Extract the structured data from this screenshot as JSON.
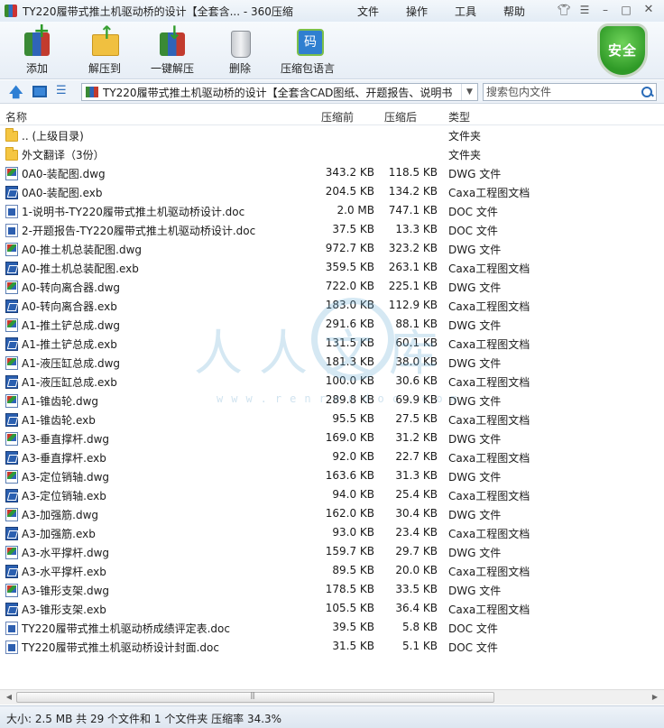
{
  "window": {
    "title": "TY220履带式推土机驱动桥的设计【全套含... - 360压缩",
    "menu": [
      "文件",
      "操作",
      "工具",
      "帮助"
    ]
  },
  "toolbar": {
    "buttons": [
      {
        "label": "添加",
        "icon": "add-archive-icon"
      },
      {
        "label": "解压到",
        "icon": "extract-to-icon"
      },
      {
        "label": "一键解压",
        "icon": "one-click-extract-icon"
      },
      {
        "label": "删除",
        "icon": "trash-icon"
      },
      {
        "label": "压缩包语言",
        "icon": "archive-language-icon"
      }
    ],
    "security_badge": "安全"
  },
  "address": {
    "path": "TY220履带式推土机驱动桥的设计【全套含CAD图纸、开题报告、说明书",
    "search_placeholder": "搜索包内文件"
  },
  "columns": {
    "name": "名称",
    "original_size": "压缩前",
    "compressed_size": "压缩后",
    "type": "类型"
  },
  "files": [
    {
      "name": ".. (上级目录)",
      "orig": "",
      "comp": "",
      "type": "文件夹",
      "icon": "folder"
    },
    {
      "name": "外文翻译（3份）",
      "orig": "",
      "comp": "",
      "type": "文件夹",
      "icon": "folder"
    },
    {
      "name": "0A0-装配图.dwg",
      "orig": "343.2 KB",
      "comp": "118.5 KB",
      "type": "DWG 文件",
      "icon": "dwg"
    },
    {
      "name": "0A0-装配图.exb",
      "orig": "204.5 KB",
      "comp": "134.2 KB",
      "type": "Caxa工程图文档",
      "icon": "exb"
    },
    {
      "name": "1-说明书-TY220履带式推土机驱动桥设计.doc",
      "orig": "2.0 MB",
      "comp": "747.1 KB",
      "type": "DOC 文件",
      "icon": "doc"
    },
    {
      "name": "2-开题报告-TY220履带式推土机驱动桥设计.doc",
      "orig": "37.5 KB",
      "comp": "13.3 KB",
      "type": "DOC 文件",
      "icon": "doc"
    },
    {
      "name": "A0-推土机总装配图.dwg",
      "orig": "972.7 KB",
      "comp": "323.2 KB",
      "type": "DWG 文件",
      "icon": "dwg"
    },
    {
      "name": "A0-推土机总装配图.exb",
      "orig": "359.5 KB",
      "comp": "263.1 KB",
      "type": "Caxa工程图文档",
      "icon": "exb"
    },
    {
      "name": "A0-转向离合器.dwg",
      "orig": "722.0 KB",
      "comp": "225.1 KB",
      "type": "DWG 文件",
      "icon": "dwg"
    },
    {
      "name": "A0-转向离合器.exb",
      "orig": "183.0 KB",
      "comp": "112.9 KB",
      "type": "Caxa工程图文档",
      "icon": "exb"
    },
    {
      "name": "A1-推土铲总成.dwg",
      "orig": "291.6 KB",
      "comp": "88.1 KB",
      "type": "DWG 文件",
      "icon": "dwg"
    },
    {
      "name": "A1-推土铲总成.exb",
      "orig": "131.5 KB",
      "comp": "60.1 KB",
      "type": "Caxa工程图文档",
      "icon": "exb"
    },
    {
      "name": "A1-液压缸总成.dwg",
      "orig": "181.3 KB",
      "comp": "38.0 KB",
      "type": "DWG 文件",
      "icon": "dwg"
    },
    {
      "name": "A1-液压缸总成.exb",
      "orig": "100.0 KB",
      "comp": "30.6 KB",
      "type": "Caxa工程图文档",
      "icon": "exb"
    },
    {
      "name": "A1-锥齿轮.dwg",
      "orig": "289.8 KB",
      "comp": "69.9 KB",
      "type": "DWG 文件",
      "icon": "dwg"
    },
    {
      "name": "A1-锥齿轮.exb",
      "orig": "95.5 KB",
      "comp": "27.5 KB",
      "type": "Caxa工程图文档",
      "icon": "exb"
    },
    {
      "name": "A3-垂直撑杆.dwg",
      "orig": "169.0 KB",
      "comp": "31.2 KB",
      "type": "DWG 文件",
      "icon": "dwg"
    },
    {
      "name": "A3-垂直撑杆.exb",
      "orig": "92.0 KB",
      "comp": "22.7 KB",
      "type": "Caxa工程图文档",
      "icon": "exb"
    },
    {
      "name": "A3-定位销轴.dwg",
      "orig": "163.6 KB",
      "comp": "31.3 KB",
      "type": "DWG 文件",
      "icon": "dwg"
    },
    {
      "name": "A3-定位销轴.exb",
      "orig": "94.0 KB",
      "comp": "25.4 KB",
      "type": "Caxa工程图文档",
      "icon": "exb"
    },
    {
      "name": "A3-加强筋.dwg",
      "orig": "162.0 KB",
      "comp": "30.4 KB",
      "type": "DWG 文件",
      "icon": "dwg"
    },
    {
      "name": "A3-加强筋.exb",
      "orig": "93.0 KB",
      "comp": "23.4 KB",
      "type": "Caxa工程图文档",
      "icon": "exb"
    },
    {
      "name": "A3-水平撑杆.dwg",
      "orig": "159.7 KB",
      "comp": "29.7 KB",
      "type": "DWG 文件",
      "icon": "dwg"
    },
    {
      "name": "A3-水平撑杆.exb",
      "orig": "89.5 KB",
      "comp": "20.0 KB",
      "type": "Caxa工程图文档",
      "icon": "exb"
    },
    {
      "name": "A3-锥形支架.dwg",
      "orig": "178.5 KB",
      "comp": "33.5 KB",
      "type": "DWG 文件",
      "icon": "dwg"
    },
    {
      "name": "A3-锥形支架.exb",
      "orig": "105.5 KB",
      "comp": "36.4 KB",
      "type": "Caxa工程图文档",
      "icon": "exb"
    },
    {
      "name": "TY220履带式推土机驱动桥成绩评定表.doc",
      "orig": "39.5 KB",
      "comp": "5.8 KB",
      "type": "DOC 文件",
      "icon": "doc"
    },
    {
      "name": "TY220履带式推土机驱动桥设计封面.doc",
      "orig": "31.5 KB",
      "comp": "5.1 KB",
      "type": "DOC 文件",
      "icon": "doc"
    }
  ],
  "watermark": {
    "text": "人人文库",
    "url": "www.renrendoc.com"
  },
  "status": {
    "text": "大小: 2.5 MB 共 29 个文件和 1 个文件夹 压缩率 34.3%"
  }
}
